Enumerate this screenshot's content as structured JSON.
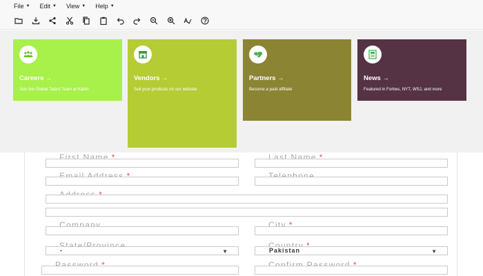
{
  "menubar": {
    "items": [
      {
        "label": "File"
      },
      {
        "label": "Edit"
      },
      {
        "label": "View"
      },
      {
        "label": "Help"
      }
    ]
  },
  "toolbar": {
    "buttons": [
      "open-folder-icon",
      "download-icon",
      "share-icon",
      "cut-icon",
      "copy-icon",
      "paste-icon",
      "undo-icon",
      "redo-icon",
      "zoom-out-icon",
      "zoom-in-icon",
      "spellcheck-icon",
      "help-icon"
    ]
  },
  "cards": {
    "careers": {
      "title": "Careers →",
      "desc": "Join the Global Talent Team at Kabin",
      "color": "#a8f04a"
    },
    "vendors": {
      "title": "Vendors →",
      "desc": "Sell your products on our website",
      "color": "#b6cc34"
    },
    "partners": {
      "title": "Partners →",
      "desc": "Become a paid affiliate",
      "color": "#8b8433"
    },
    "news": {
      "title": "News →",
      "desc": "Featured in Forbes, NYT, WSJ, and more",
      "color": "#553244"
    }
  },
  "form": {
    "first_name": "First Name",
    "last_name": "Last Name",
    "email": "Email Address",
    "telephone": "Telephone",
    "address": "Address",
    "company": "Company",
    "city": "City",
    "state": "State/Province",
    "state_value": "-",
    "country": "Country",
    "country_value": "Pakistan",
    "password": "Password",
    "confirm_password": "Confirm Password",
    "required_mark": "*"
  }
}
